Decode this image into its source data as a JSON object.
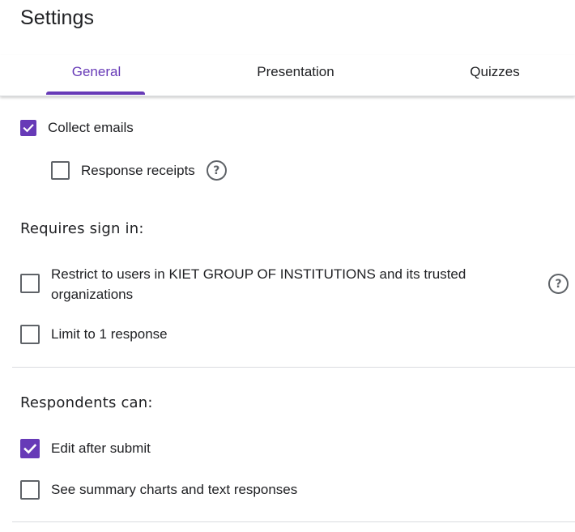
{
  "header": {
    "title": "Settings"
  },
  "tabs": [
    {
      "label": "General",
      "selected": true
    },
    {
      "label": "Presentation",
      "selected": false
    },
    {
      "label": "Quizzes",
      "selected": false
    }
  ],
  "colors": {
    "accent": "#673ab7",
    "text": "#202124",
    "icon": "#5f6368",
    "divider": "#dadce0"
  },
  "general": {
    "collect_emails": {
      "label": "Collect emails",
      "checked": true
    },
    "response_receipts": {
      "label": "Response receipts",
      "checked": false,
      "help_icon": "help-circle-icon"
    },
    "requires_sign_in": {
      "heading": "Requires sign in:",
      "restrict_users": {
        "label_line1": "Restrict to users in KIET GROUP OF INSTITUTIONS and its trusted",
        "label_line2": "organizations",
        "checked": false,
        "help_icon": "help-circle-icon"
      },
      "limit_response": {
        "label": "Limit to 1 response",
        "checked": false
      }
    },
    "respondents_can": {
      "heading": "Respondents can:",
      "edit_after_submit": {
        "label": "Edit after submit",
        "checked": true
      },
      "see_summary": {
        "label": "See summary charts and text responses",
        "checked": false
      }
    }
  }
}
